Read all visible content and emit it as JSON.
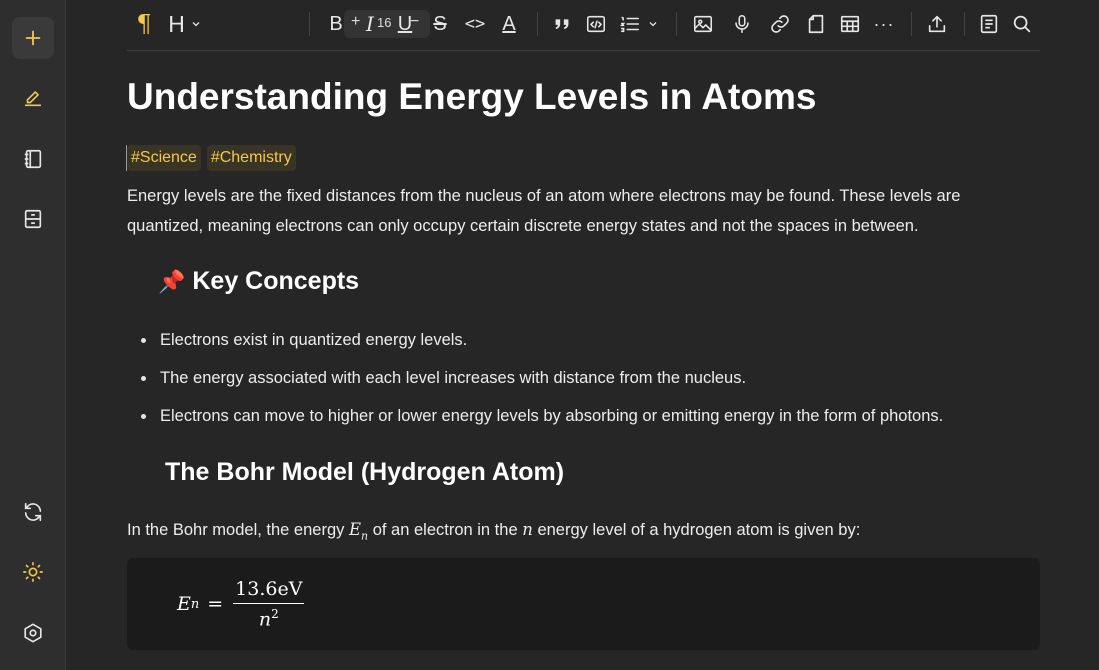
{
  "sidebar": {
    "items": [
      {
        "name": "add",
        "icon": "plus-icon"
      },
      {
        "name": "edit",
        "icon": "pencil-icon"
      },
      {
        "name": "notebooks",
        "icon": "notebook-icon"
      },
      {
        "name": "archive",
        "icon": "archive-icon"
      },
      {
        "name": "sync",
        "icon": "sync-icon"
      },
      {
        "name": "theme",
        "icon": "sun-icon"
      },
      {
        "name": "settings",
        "icon": "hexagon-settings-icon"
      }
    ],
    "accent": "#f2c94c"
  },
  "toolbar": {
    "paragraph_glyph": "¶",
    "heading_label": "H",
    "font_size_plus": "+",
    "font_size": "16",
    "font_size_minus": "−",
    "bold": "B",
    "italic": "I",
    "underline": "U",
    "strike": "S",
    "code": "<>",
    "text_color": "A",
    "quote": "99",
    "more": "···"
  },
  "document": {
    "title": "Understanding Energy Levels in Atoms",
    "tags": [
      "#Science",
      "#Chemistry"
    ],
    "intro": "Energy levels are the fixed distances from the nucleus of an atom where electrons may be found. These levels are quantized, meaning electrons can only occupy certain discrete energy states and not the spaces in between.",
    "key_concepts_emoji": "📌",
    "key_concepts_heading": "Key Concepts",
    "bullets": [
      "Electrons exist in quantized energy levels.",
      "The energy associated with each level increases with distance from the nucleus.",
      "Electrons can move to higher or lower energy levels by absorbing or emitting energy in the form of photons."
    ],
    "bohr_heading": "The Bohr Model (Hydrogen Atom)",
    "bohr_text_1": "In the Bohr model, the energy ",
    "bohr_var_E": "E",
    "bohr_var_E_sub": "n",
    "bohr_text_2": " of an electron in the ",
    "bohr_var_n": "n",
    "bohr_text_3": " energy level of a hydrogen atom is given by:",
    "equation": {
      "lhs": "E",
      "lhs_sub": "n",
      "equals": "=",
      "numerator": "13.6eV",
      "denominator": "n",
      "denominator_sup": "2"
    }
  }
}
